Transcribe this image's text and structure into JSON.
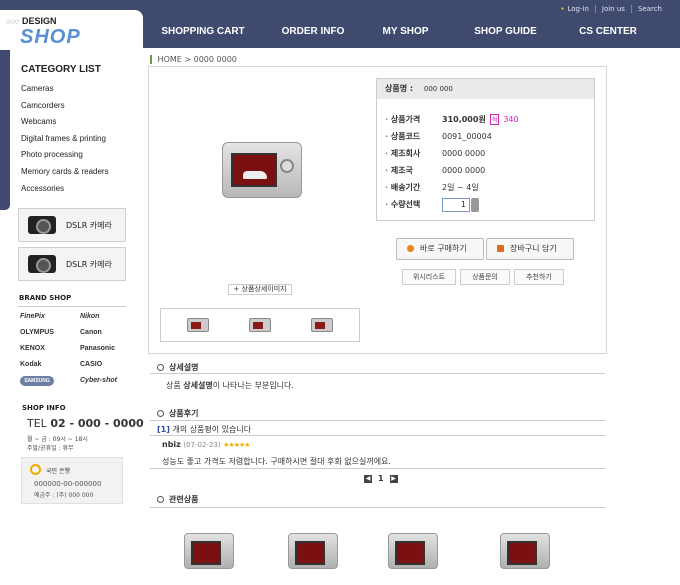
{
  "header": {
    "top_links": [
      "Log-in",
      "Join us",
      "Search"
    ],
    "nav": [
      "SHOPPING CART",
      "ORDER INFO",
      "MY SHOP",
      "SHOP GUIDE",
      "CS CENTER"
    ]
  },
  "logo": {
    "design": "DESIGN",
    "shop": "SHOP",
    "dots": "○○○"
  },
  "sidebar": {
    "category_title": "CATEGORY LIST",
    "categories": [
      "Cameras",
      "Camcorders",
      "Webcams",
      "Digital frames & printing",
      "Photo processing",
      "Memory cards & readers",
      "Accessories"
    ],
    "banners": [
      "DSLR 카메라",
      "DSLR 카메라"
    ],
    "brand_title": "BRAND SHOP",
    "brands": [
      "FinePix",
      "Nikon",
      "OLYMPUS",
      "Canon",
      "KENOX",
      "Panasonic",
      "Kodak",
      "CASIO",
      "SAMSUNG",
      "Cyber-shot"
    ],
    "shop_info": {
      "title": "SHOP INFO",
      "tel_label": "TEL",
      "tel": "02 - 000 - 0000",
      "hours_line1": "월 ~ 금   :   09시 ~ 18시",
      "hours_line2": "주말/공휴일 : 휴무",
      "bank_name": "국민 은행",
      "account": "000000-00-000000",
      "owner": "예금주 : (주) 000 000"
    }
  },
  "breadcrumb": {
    "home": "HOME",
    "separator": ">",
    "current": "0000 0000"
  },
  "product": {
    "name_label": "상품명 :",
    "name": "000 000",
    "rows": [
      {
        "label": "상품가격",
        "value": "310,000원",
        "point": "340"
      },
      {
        "label": "상품코드",
        "value": "0091_00004"
      },
      {
        "label": "제조회사",
        "value": "0000 0000"
      },
      {
        "label": "제조국",
        "value": "0000 0000"
      },
      {
        "label": "배송기간",
        "value": "2일 ~ 4일"
      },
      {
        "label": "수량선택",
        "value": "1"
      }
    ],
    "point_badge": "적",
    "buy_now": "바로 구매하기",
    "add_cart": "장바구니 담기",
    "wishlist": "위시리스트",
    "inquiry": "상품문의",
    "recommend": "추천하기",
    "detail_image": "상품상세이미지"
  },
  "sections": {
    "detail_title": "상세설명",
    "detail_text_pre": "상품 ",
    "detail_text_bold": "상세설명",
    "detail_text_post": "이 나타나는 부분입니다.",
    "review_title": "상품후기",
    "review_count_prefix": "[1]",
    "review_count_text": "개의 상품평이 있습니다",
    "reviewer": "nbiz",
    "review_date": "(07-02-23)",
    "review_stars": "★★★★★",
    "review_body": "성능도 좋고 가격도 저렴합니다. 구매하시면 절대 후회 없으실꺼에요.",
    "page_current": "1",
    "related_title": "관련상품"
  },
  "watermark": "Point Shop",
  "colors": {
    "header_bg": "#3f4a6e",
    "price": "#f07020",
    "point": "#d020c0",
    "accent_green": "#6a9a4a"
  }
}
